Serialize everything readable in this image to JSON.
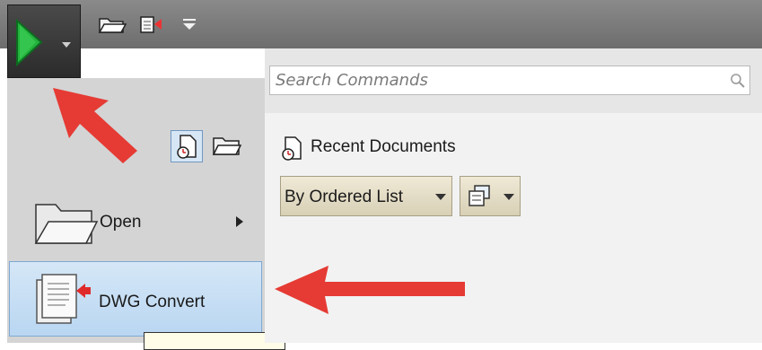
{
  "search": {
    "placeholder": "Search Commands"
  },
  "recent": {
    "title": "Recent Documents",
    "sort_dropdown_label": "By Ordered List"
  },
  "menu": {
    "open_label": "Open",
    "dwg_convert_label": "DWG Convert"
  },
  "icons": {
    "app_button": "green-play-icon",
    "quick_access": [
      "open-folder-icon",
      "dwg-convert-icon",
      "customize-dropdown-icon"
    ],
    "view_toggle": [
      "recent-documents-icon",
      "open-documents-icon"
    ],
    "search": "search-icon",
    "annotation": "red-arrow"
  },
  "colors": {
    "accent_green": "#1fa23a",
    "annotation_red": "#e53b34",
    "selection_blue": "#b9d6f1"
  }
}
